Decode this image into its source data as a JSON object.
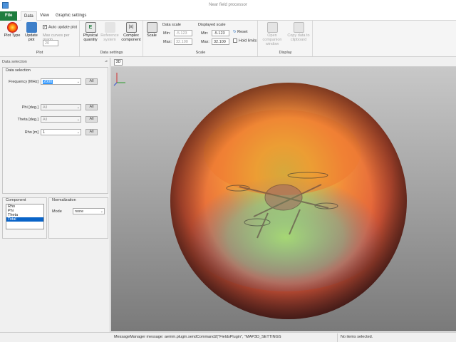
{
  "window": {
    "title": "Near field processor"
  },
  "tabs": {
    "file": "File",
    "data": "Data",
    "view": "View",
    "graphic": "Graphic settings"
  },
  "ribbon": {
    "plot": {
      "group_label": "Plot",
      "plot_type": "Plot Type",
      "update_plot": "Update plot",
      "auto_update": "Auto update plot",
      "max_curves_label": "Max curves per graph",
      "max_curves_value": "20"
    },
    "data_settings": {
      "group_label": "Data settings",
      "physical_quantity": "Physical quantity",
      "reference_system": "Reference system",
      "complex_component": "Complex component"
    },
    "scale": {
      "group_label": "Scale",
      "scale_button": "Scale",
      "data_scale": "Data scale",
      "displayed_scale": "Displayed scale",
      "min_label": "Min:",
      "max_label": "Max:",
      "data_min": "-5.123",
      "data_max": "32.100",
      "disp_min": "-5.123",
      "disp_max": "32.100",
      "reset": "Reset",
      "hold_limits": "Hold limits"
    },
    "display": {
      "group_label": "Display",
      "open_companion": "Open companion window",
      "copy_data": "Copy data to clipboard"
    }
  },
  "left": {
    "panel_title": "Data selection",
    "selection_box_title": "Data selection",
    "frequency_label": "Frequency [MHz]",
    "frequency_value": "2000",
    "phi_label": "Phi [deg.]",
    "phi_value": "All",
    "theta_label": "Theta [deg.]",
    "theta_value": "All",
    "rho_label": "Rho [m]",
    "rho_value": "1",
    "all_label": "All",
    "component_title": "Component",
    "components": [
      "Rho",
      "Phi",
      "Theta",
      "Total"
    ],
    "normalization_title": "Normalization",
    "mode_label": "Mode",
    "mode_value": "none"
  },
  "viewport": {
    "tab_label": "3D"
  },
  "status": {
    "message": "MessageManager message: aemm.plugin.sendCommand2(\"FieldsPlugin\", \"MAP3D_SETTINGS",
    "selection": "No items selected."
  }
}
